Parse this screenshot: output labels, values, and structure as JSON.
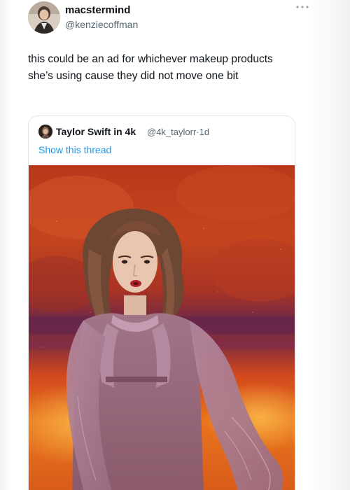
{
  "tweet": {
    "author_name": "macstermind",
    "author_handle": "@kenziecoffman",
    "more_icon": "more-horizontal-icon",
    "text": "this could be an ad for whichever makeup products she’s using cause they did not move one bit"
  },
  "quote": {
    "author_name": "Taylor Swift in 4k",
    "author_handle": "@4k_taylorr",
    "separator": "·",
    "time": "1d",
    "link_label": "Show this thread",
    "media_icon": "photo"
  },
  "colors": {
    "link": "#1d9bf0",
    "secondary_text": "#536471",
    "border": "#e1e6ea"
  }
}
